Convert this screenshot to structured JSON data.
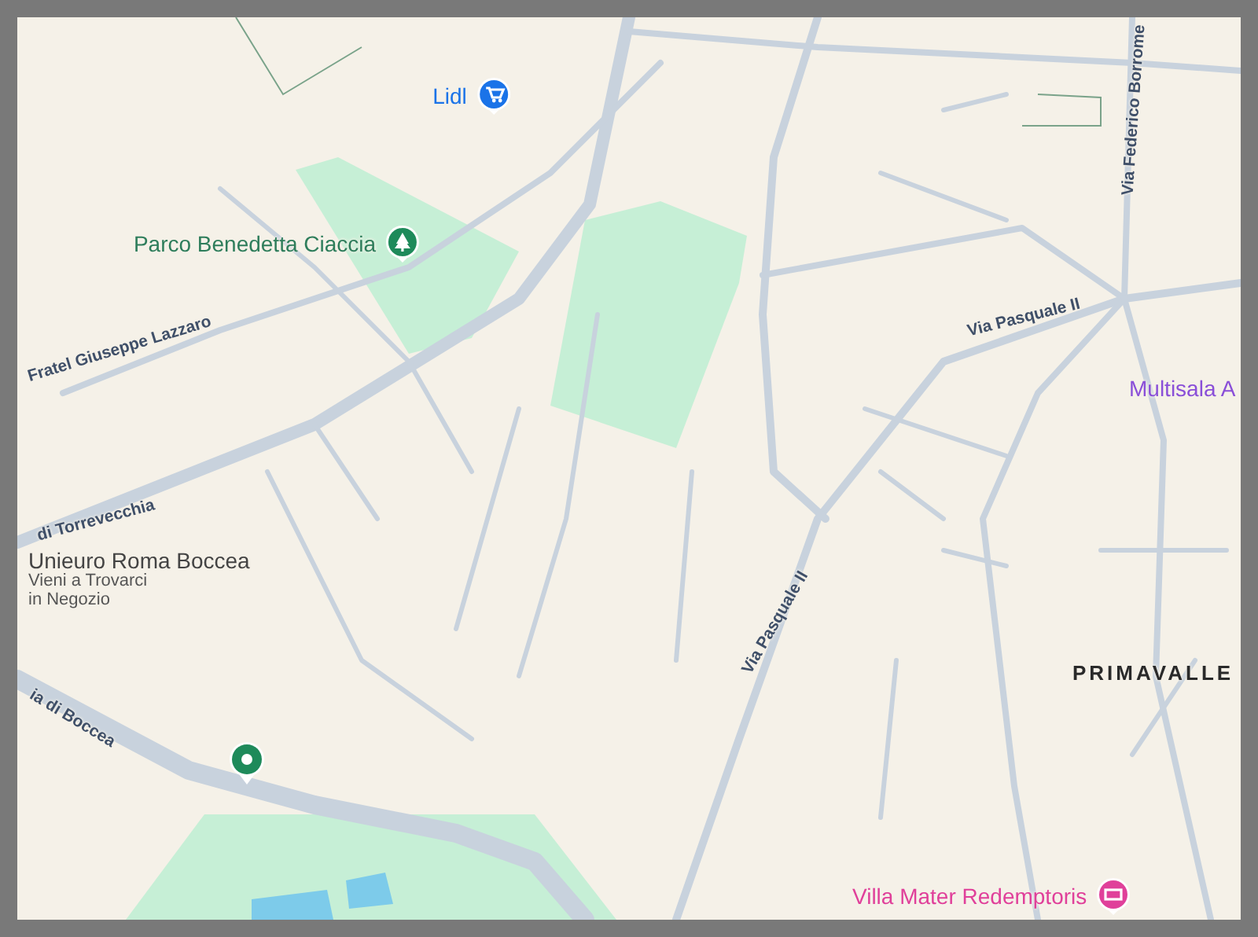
{
  "map": {
    "labels": [
      {
        "kind": "shop",
        "text": "Lidl"
      },
      {
        "kind": "park",
        "text": "Parco Benedetta Ciaccia"
      },
      {
        "kind": "street",
        "text": "Fratel Giuseppe Lazzaro"
      },
      {
        "kind": "street",
        "text": "di Torrevecchia"
      },
      {
        "kind": "place",
        "text": "Unieuro Roma Boccea",
        "subtitle": "Vieni a Trovarci in Negozio"
      },
      {
        "kind": "street",
        "text": "ia di Boccea"
      },
      {
        "kind": "street",
        "text": "Via Pasquale II"
      },
      {
        "kind": "street",
        "text": "Via Pasquale II"
      },
      {
        "kind": "street",
        "text": "Via Federico Borrome"
      },
      {
        "kind": "cinema",
        "text": "Multisala A"
      },
      {
        "kind": "district",
        "text": "PRIMAVALLE"
      },
      {
        "kind": "lodging",
        "text": "Villa Mater Redemptoris"
      }
    ]
  }
}
